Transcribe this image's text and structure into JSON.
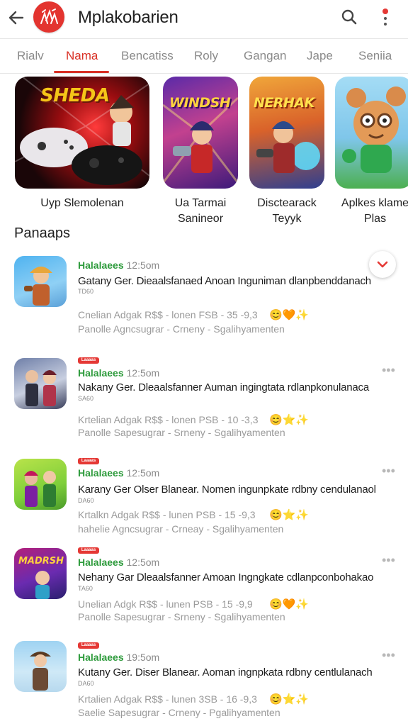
{
  "header": {
    "title": "Mplakobarien"
  },
  "tabs": [
    "Rialv",
    "Nama",
    "Bencatiss",
    "Roly",
    "Gangan",
    "Jape",
    "Seniia"
  ],
  "featured": [
    {
      "art_title": "SHEDA",
      "label_lines": [
        "Uyp Slemolenan"
      ]
    },
    {
      "art_title": "WINDSH",
      "label_lines": [
        "Ua Tarmai",
        "Sanineor"
      ]
    },
    {
      "art_title": "NERHAK",
      "label_lines": [
        "Disctearack",
        "Teyyk"
      ]
    },
    {
      "art_title": "",
      "label_lines": [
        "Aplkes klame",
        "Plas"
      ]
    }
  ],
  "section_title": "Panaaps",
  "list": [
    {
      "badge": "",
      "publisher": "Halalaees",
      "time": "12:5om",
      "title": "Gatany Ger. Dieaalsfanaed Anoan Inguniman  dlanpbenddanach",
      "sub": "TD60",
      "line1": "Cnelian  Adgak  R$$ - lonen  FSB - 35 -9,3",
      "line2": "Panolle  Agncsugrar - Crneny - Sgalihyamenten",
      "has_more": false
    },
    {
      "badge": "Laaaas",
      "publisher": "Halalaees",
      "time": "12:5om",
      "title": "Nakany Ger. Dleaalsfanner Auman ingingtata rdlanpkonulanaca",
      "sub": "SA60",
      "line1": "Krtelian  Adgak  R$$ - lonen  PSB - 10 -3,3",
      "line2": "Panolle  Sapesugrar - Srneny - Sgalihyamenten",
      "has_more": true
    },
    {
      "badge": "Laaaas",
      "publisher": "Halalaees",
      "time": "12:5om",
      "title": "Karany Ger Olser Blanear. Nomen ingunpkate rdbny cendulanaol",
      "sub": "DA60",
      "line1": "Krtalkn  Adgak  R$$ - lunen  PSB - 15 -9,3",
      "line2": "hahelie  Agncsugrar - Crneay - Sgalihyamenten",
      "has_more": true
    },
    {
      "badge": "Laaaas",
      "publisher": "Halalaees",
      "time": "12:5om",
      "title": "Nehany Gar Dleaalsfanner Amoan Ingngkate cdlanpconbohakao",
      "sub": "TA60",
      "line1": "Unelian  Adgk  R$$ - lunen  PSB - 15 -9,9",
      "line2": "Panolle  Sapesugrar - Srneny - Sgalihyamenten",
      "has_more": true
    },
    {
      "badge": "Laaaas",
      "publisher": "Halalaees",
      "time": "19:5om",
      "title": "Kutany Ger. Diser Blanear. Aoman ingnpkata rdbny centlulanach",
      "sub": "DA60",
      "line1": "Krtalien  Adgak  R$$ - lunen  3SB - 16 -9,3",
      "line2": "Saelie  Sapesugrar - Crneny - Pgalihyamenten",
      "has_more": true
    }
  ],
  "colors": {
    "accent": "#d93025",
    "publisher_green": "#2e9b3c",
    "muted_text": "#9a9a9a"
  },
  "icons": [
    "back-arrow-icon",
    "logo-icon",
    "search-icon",
    "more-vert-icon",
    "chevron-down-icon",
    "more-horiz-icon"
  ]
}
